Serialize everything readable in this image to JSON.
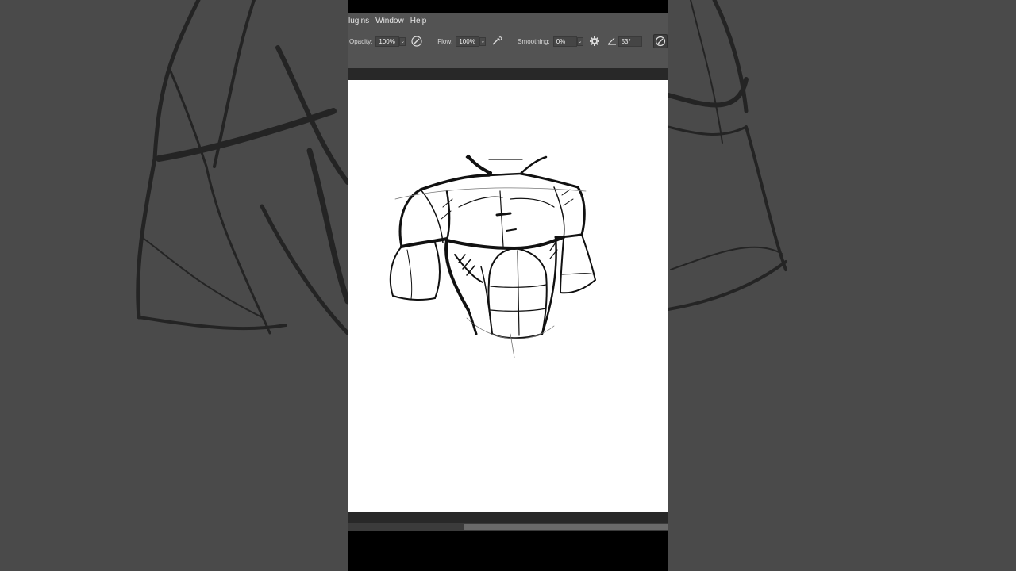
{
  "menu": {
    "items": [
      "lugins",
      "Window",
      "Help"
    ]
  },
  "options": {
    "opacity_label": "Opacity:",
    "opacity_value": "100%",
    "flow_label": "Flow:",
    "flow_value": "100%",
    "smoothing_label": "Smoothing:",
    "smoothing_value": "0%",
    "angle_value": "53°",
    "chevron": "⌄"
  },
  "icons": {
    "pressure_opacity": "pen-pressure-icon",
    "airbrush": "airbrush-icon",
    "settings": "gear-icon",
    "angle": "angle-icon",
    "pressure_size": "pen-pressure-size-icon",
    "symmetry": "butterfly-icon"
  },
  "colors": {
    "ui_panel": "#535353",
    "canvas": "#ffffff",
    "surround": "#4a4a4a"
  }
}
